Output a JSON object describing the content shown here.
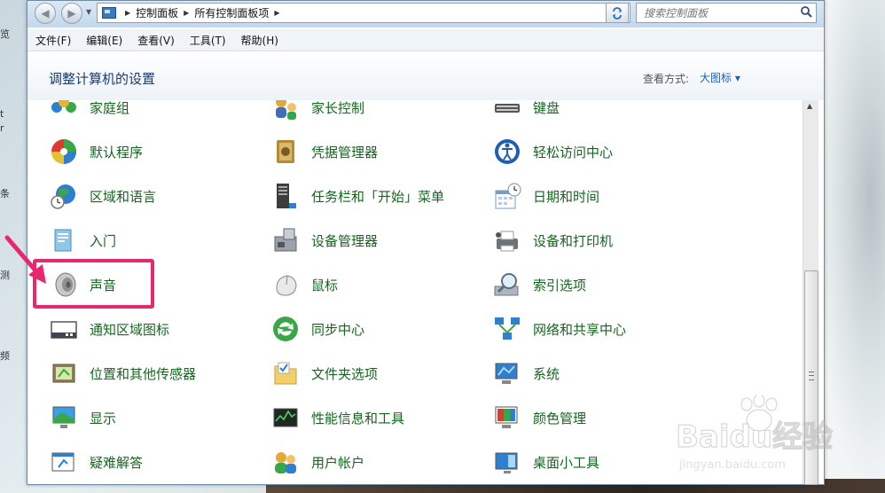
{
  "desktop": {
    "fragments": [
      "览",
      "t",
      "r",
      "条",
      "测",
      "频"
    ]
  },
  "window": {
    "breadcrumb": [
      "控制面板",
      "所有控制面板项"
    ],
    "search_placeholder": "搜索控制面板",
    "menu": [
      "文件(F)",
      "编辑(E)",
      "查看(V)",
      "工具(T)",
      "帮助(H)"
    ],
    "page_title": "调整计算机的设置",
    "view_by_label": "查看方式:",
    "view_by_value": "大图标 ▾"
  },
  "items": [
    {
      "label": "家庭组",
      "icon": "homegroup-icon"
    },
    {
      "label": "家长控制",
      "icon": "parental-controls-icon"
    },
    {
      "label": "键盘",
      "icon": "keyboard-icon"
    },
    {
      "label": "默认程序",
      "icon": "default-programs-icon"
    },
    {
      "label": "凭据管理器",
      "icon": "credential-manager-icon"
    },
    {
      "label": "轻松访问中心",
      "icon": "ease-of-access-icon"
    },
    {
      "label": "区域和语言",
      "icon": "region-language-icon"
    },
    {
      "label": "任务栏和「开始」菜单",
      "icon": "taskbar-start-menu-icon"
    },
    {
      "label": "日期和时间",
      "icon": "date-time-icon"
    },
    {
      "label": "入门",
      "icon": "getting-started-icon"
    },
    {
      "label": "设备管理器",
      "icon": "device-manager-icon"
    },
    {
      "label": "设备和打印机",
      "icon": "devices-printers-icon"
    },
    {
      "label": "声音",
      "icon": "sound-icon"
    },
    {
      "label": "鼠标",
      "icon": "mouse-icon"
    },
    {
      "label": "索引选项",
      "icon": "indexing-options-icon"
    },
    {
      "label": "通知区域图标",
      "icon": "notification-area-icon"
    },
    {
      "label": "同步中心",
      "icon": "sync-center-icon"
    },
    {
      "label": "网络和共享中心",
      "icon": "network-sharing-icon"
    },
    {
      "label": "位置和其他传感器",
      "icon": "location-sensors-icon"
    },
    {
      "label": "文件夹选项",
      "icon": "folder-options-icon"
    },
    {
      "label": "系统",
      "icon": "system-icon"
    },
    {
      "label": "显示",
      "icon": "display-icon"
    },
    {
      "label": "性能信息和工具",
      "icon": "performance-icon"
    },
    {
      "label": "颜色管理",
      "icon": "color-management-icon"
    },
    {
      "label": "疑难解答",
      "icon": "troubleshooting-icon"
    },
    {
      "label": "用户帐户",
      "icon": "user-accounts-icon"
    },
    {
      "label": "桌面小工具",
      "icon": "desktop-gadgets-icon"
    }
  ],
  "watermark": {
    "brand": "Baidu经验",
    "url": "jingyan.baidu.com"
  }
}
